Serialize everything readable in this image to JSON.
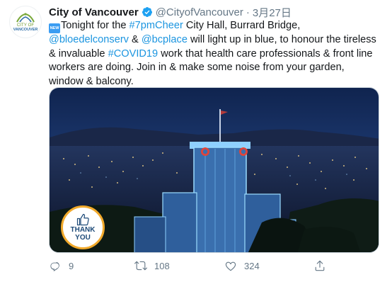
{
  "tweet": {
    "author_name": "City of Vancouver",
    "handle": "@CityofVancouver",
    "separator": "·",
    "date": "3月27日",
    "text_parts": {
      "p1": "Tonight for the ",
      "hashtag1": "#7pmCheer",
      "p2": " City Hall, Burrard Bridge,",
      "mention1": "@bloedelconserv",
      "p3": " & ",
      "mention2": "@bcplace",
      "p4": " will light up in blue, to honour the tireless & invaluable ",
      "hashtag2": "#COVID19",
      "p5": " work that health care professionals & front line workers are doing. Join in & make some noise from your garden, window & balcony."
    },
    "new_badge": "NEW",
    "avatar_label_top": "CITY OF",
    "avatar_label_bottom": "VANCOUVER"
  },
  "media": {
    "badge_line1": "THANK",
    "badge_line2": "YOU"
  },
  "actions": {
    "replies": "9",
    "retweets": "108",
    "likes": "324"
  },
  "colors": {
    "link": "#1b95e0",
    "verified": "#1da1f2",
    "muted": "#657786",
    "night_sky": "#1a2f5a"
  }
}
